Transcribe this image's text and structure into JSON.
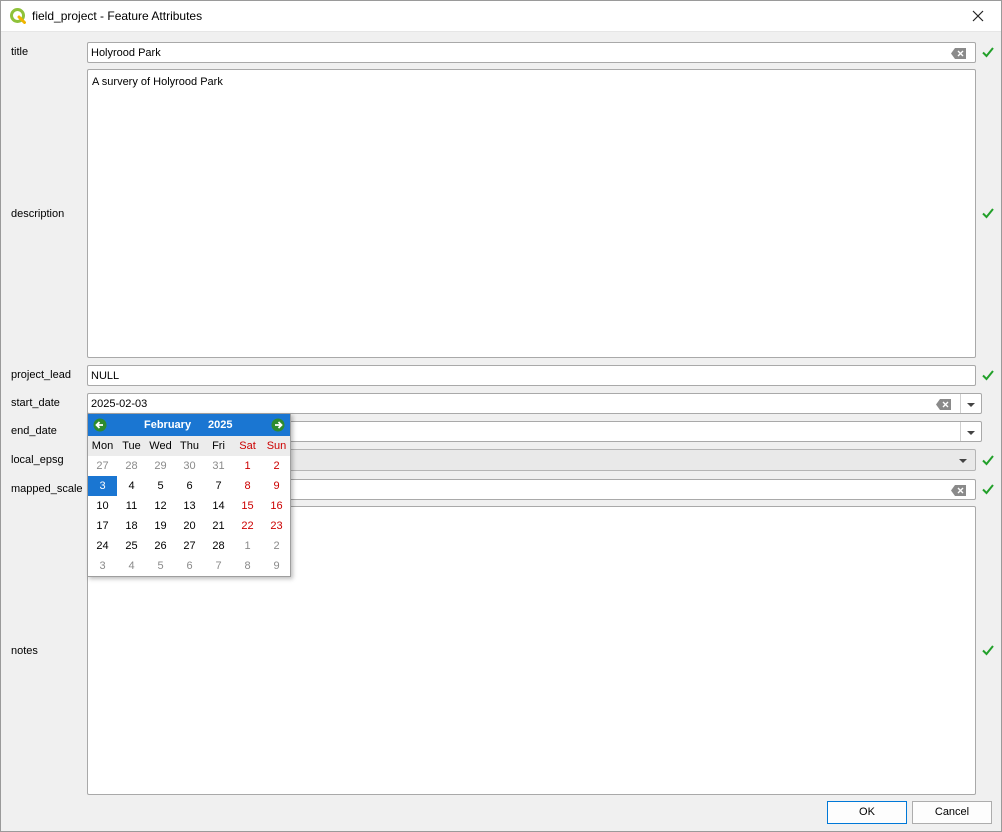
{
  "window": {
    "title": "field_project - Feature Attributes",
    "accent": "#1a76d2",
    "check_color": "#22a02a",
    "weekend_color": "#cc0000"
  },
  "fields": {
    "title": {
      "label": "title",
      "value": "Holyrood Park"
    },
    "description": {
      "label": "description",
      "value": "A survery of Holyrood Park"
    },
    "project_lead": {
      "label": "project_lead",
      "value": "NULL"
    },
    "start_date": {
      "label": "start_date",
      "value": "2025-02-03"
    },
    "end_date": {
      "label": "end_date",
      "value": ""
    },
    "local_epsg": {
      "label": "local_epsg",
      "value": ""
    },
    "mapped_scale": {
      "label": "mapped_scale",
      "value": ""
    },
    "notes": {
      "label": "notes",
      "value": ""
    }
  },
  "calendar": {
    "month": "February",
    "year": "2025",
    "weekdays": [
      "Mon",
      "Tue",
      "Wed",
      "Thu",
      "Fri",
      "Sat",
      "Sun"
    ],
    "selected": "3",
    "weeks": [
      [
        {
          "d": "27",
          "other": true
        },
        {
          "d": "28",
          "other": true
        },
        {
          "d": "29",
          "other": true
        },
        {
          "d": "30",
          "other": true
        },
        {
          "d": "31",
          "other": true
        },
        {
          "d": "1"
        },
        {
          "d": "2"
        }
      ],
      [
        {
          "d": "3"
        },
        {
          "d": "4"
        },
        {
          "d": "5"
        },
        {
          "d": "6"
        },
        {
          "d": "7"
        },
        {
          "d": "8"
        },
        {
          "d": "9"
        }
      ],
      [
        {
          "d": "10"
        },
        {
          "d": "11"
        },
        {
          "d": "12"
        },
        {
          "d": "13"
        },
        {
          "d": "14"
        },
        {
          "d": "15"
        },
        {
          "d": "16"
        }
      ],
      [
        {
          "d": "17"
        },
        {
          "d": "18"
        },
        {
          "d": "19"
        },
        {
          "d": "20"
        },
        {
          "d": "21"
        },
        {
          "d": "22"
        },
        {
          "d": "23"
        }
      ],
      [
        {
          "d": "24"
        },
        {
          "d": "25"
        },
        {
          "d": "26"
        },
        {
          "d": "27"
        },
        {
          "d": "28"
        },
        {
          "d": "1",
          "other": true
        },
        {
          "d": "2",
          "other": true
        }
      ],
      [
        {
          "d": "3",
          "other": true
        },
        {
          "d": "4",
          "other": true
        },
        {
          "d": "5",
          "other": true
        },
        {
          "d": "6",
          "other": true
        },
        {
          "d": "7",
          "other": true
        },
        {
          "d": "8",
          "other": true
        },
        {
          "d": "9",
          "other": true
        }
      ]
    ]
  },
  "buttons": {
    "ok": "OK",
    "cancel": "Cancel"
  },
  "icons": {
    "app": "qgis-logo-icon",
    "close": "close-icon",
    "clear": "clear-text-icon",
    "check": "checkmark-icon",
    "prev": "prev-month-arrow-icon",
    "next": "next-month-arrow-icon"
  }
}
